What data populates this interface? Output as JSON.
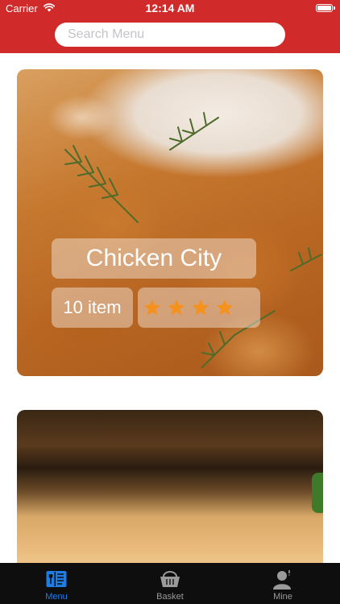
{
  "status_bar": {
    "carrier": "Carrier",
    "time": "12:14 AM"
  },
  "search": {
    "placeholder": "Search Menu",
    "value": ""
  },
  "cards": [
    {
      "title": "Chicken City",
      "item_count": "10 item",
      "rating_stars": 4
    },
    {
      "title": "",
      "item_count": ""
    }
  ],
  "tabs": [
    {
      "label": "Menu",
      "icon": "menu-book-icon",
      "active": true
    },
    {
      "label": "Basket",
      "icon": "basket-icon",
      "active": false
    },
    {
      "label": "Mine",
      "icon": "person-icon",
      "active": false
    }
  ],
  "colors": {
    "header_red": "#d12a2a",
    "active_tab": "#1e7ce6",
    "inactive_tab": "#9a9a9a",
    "star": "#f5921e",
    "tabbar_bg": "#0e0e0e"
  }
}
